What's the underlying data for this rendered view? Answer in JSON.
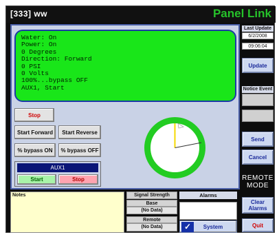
{
  "title": {
    "left": "[333]  ww",
    "right": "Panel Link"
  },
  "status_lines": [
    "Water: On",
    "Power: On",
    "0 Degrees",
    "Direction: Forward",
    "0 PSI",
    "0 Volts",
    "100%...bypass OFF",
    "AUX1, Start"
  ],
  "controls": {
    "stop": "Stop",
    "start_forward": "Start Forward",
    "start_reverse": "Start Reverse",
    "bypass_on": "% bypass ON",
    "bypass_off": "% bypass OFF"
  },
  "aux": {
    "header": "AUX1",
    "start": "Start",
    "stop": "Stop"
  },
  "right": {
    "last_update_label": "Last Update",
    "date": "6/2/2008",
    "time": "09:06:04",
    "update": "Update",
    "notice_event_label": "Notice Event",
    "send": "Send",
    "cancel": "Cancel",
    "remote_mode_1": "REMOTE",
    "remote_mode_2": "MODE",
    "clear_alarms_1": "Clear",
    "clear_alarms_2": "Alarms",
    "quit": "Quit"
  },
  "bottom": {
    "notes_label": "Notes",
    "signal_strength": "Signal Strength",
    "base_label": "Base",
    "base_value": "(No Data)",
    "remote_label": "Remote",
    "remote_value": "(No Data)",
    "alarms_label": "Alarms",
    "system": "System"
  },
  "colors": {
    "title_right": "#26c22a",
    "status_bg": "#19e619",
    "gauge_ring": "#22cc22",
    "pointer_yellow": "#f5d800",
    "stop_red": "#d00000"
  }
}
